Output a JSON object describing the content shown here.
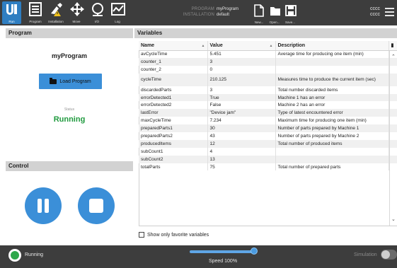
{
  "topbar": {
    "nav": [
      {
        "label": "Run",
        "icon": "run-logo-icon"
      },
      {
        "label": "Program",
        "icon": "program-icon"
      },
      {
        "label": "Installation",
        "icon": "installation-icon"
      },
      {
        "label": "Move",
        "icon": "move-icon"
      },
      {
        "label": "I/O",
        "icon": "io-icon"
      },
      {
        "label": "Log",
        "icon": "log-icon"
      }
    ],
    "program_key": "PROGRAM",
    "program_value": "myProgram",
    "installation_key": "INSTALLATION",
    "installation_value": "default",
    "file_buttons": [
      {
        "label": "New...",
        "icon": "new-file-icon"
      },
      {
        "label": "Open...",
        "icon": "open-folder-icon"
      },
      {
        "label": "Save...",
        "icon": "save-icon"
      }
    ],
    "robot_name_1": "cccc",
    "robot_name_2": "cccc"
  },
  "program_panel": {
    "header": "Program",
    "program_name": "myProgram",
    "load_button": "Load Program",
    "status_label": "Status",
    "status_value": "Running"
  },
  "control_panel": {
    "header": "Control"
  },
  "variables_panel": {
    "header": "Variables",
    "columns": [
      "Name",
      "Value",
      "Description"
    ],
    "rows": [
      {
        "name": "avCycleTime",
        "value": "5.451",
        "description": "Average time for producing one item (min)"
      },
      {
        "name": "counter_1",
        "value": "3",
        "description": ""
      },
      {
        "name": "counter_2",
        "value": "0",
        "description": ""
      },
      {
        "name": "cycleTime",
        "value": "210.125",
        "description": "Measures time to produce the current item (sec)"
      },
      {
        "name": "discardedParts",
        "value": "3",
        "description": "Total number discarded items"
      },
      {
        "name": "errorDetected1",
        "value": "True",
        "description": "Machine 1 has an error"
      },
      {
        "name": "errorDetected2",
        "value": "False",
        "description": "Machine 2 has an error"
      },
      {
        "name": "lastError",
        "value": "\"Device jam\"",
        "description": "Type of latest encountered error"
      },
      {
        "name": "maxCycleTime",
        "value": "7.234",
        "description": "Maximum time for producing one item (min)"
      },
      {
        "name": "preparedParts1",
        "value": "30",
        "description": "Number of parts prepared by Machine 1"
      },
      {
        "name": "preparedParts2",
        "value": "43",
        "description": "Number of parts prepared by Machine 2"
      },
      {
        "name": "producedItems",
        "value": "12",
        "description": "Total number of produced items"
      },
      {
        "name": "subCount1",
        "value": "4",
        "description": ""
      },
      {
        "name": "subCount2",
        "value": "13",
        "description": ""
      },
      {
        "name": "totalParts",
        "value": "75",
        "description": "Total number of prepared parts"
      }
    ],
    "favorite_checkbox_label": "Show only favorite variables"
  },
  "footer": {
    "status": "Running",
    "speed_label": "Speed 100%",
    "speed_fraction": 1.0,
    "simulation_label": "Simulation"
  },
  "colors": {
    "accent": "#3b8fd8",
    "running_green": "#1f9a3e",
    "bar_dark": "#3d3d3d"
  }
}
